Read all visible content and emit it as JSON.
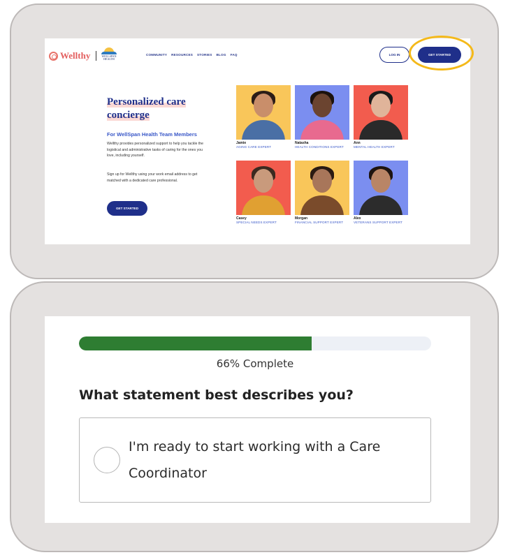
{
  "site": {
    "brand": "Wellthy",
    "partner_brand": "WELLSPAN",
    "partner_sub": "HEALTH",
    "nav_links": [
      "COMMUNITY",
      "RESOURCES",
      "STORIES",
      "BLOG",
      "FAQ"
    ],
    "login_label": "LOG IN",
    "get_started_label": "GET STARTED",
    "highlight_color": "#f4b91a",
    "hero": {
      "title": "Personalized care concierge",
      "subtitle": "For WellSpan Health Team Members",
      "paragraph1": "Wellthy provides personalized support to help you tackle the logistical and administrative tasks of caring for the ones you love, including yourself.",
      "paragraph2": "Sign up for Wellthy using your work email address to get matched with a dedicated care professional.",
      "cta_label": "GET STARTED"
    },
    "experts": [
      {
        "name": "Jamie",
        "role": "AGING CARE EXPERT",
        "bg": "#f9c65a"
      },
      {
        "name": "Natasha",
        "role": "HEALTH CONDITIONS EXPERT",
        "bg": "#7b8ef0"
      },
      {
        "name": "Ann",
        "role": "MENTAL HEALTH EXPERT",
        "bg": "#f25c4e"
      },
      {
        "name": "Casey",
        "role": "SPECIAL NEEDS EXPERT",
        "bg": "#f25c4e"
      },
      {
        "name": "Morgan",
        "role": "FINANCIAL SUPPORT EXPERT",
        "bg": "#f9c65a"
      },
      {
        "name": "Alex",
        "role": "VETERANS SUPPORT EXPERT",
        "bg": "#7b8ef0"
      }
    ]
  },
  "survey": {
    "progress_fraction": 0.66,
    "progress_text": "66% Complete",
    "progress_color": "#2e7d32",
    "question": "What statement best describes you?",
    "option_label": "I'm ready to start working with a Care Coordinator"
  }
}
